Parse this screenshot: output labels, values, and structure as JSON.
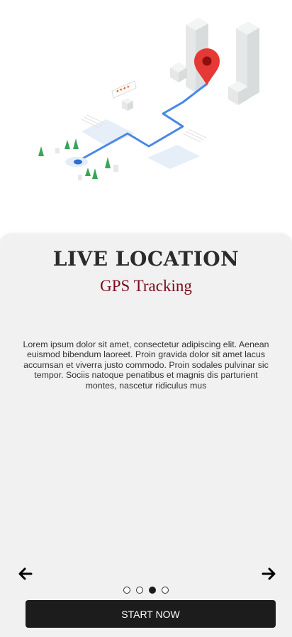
{
  "onboarding": {
    "title": "Live Location",
    "subtitle": "GPS Tracking",
    "description": "Lorem ipsum dolor sit amet, consectetur adipiscing elit. Aenean euismod bibendum laoreet. Proin gravida dolor sit amet lacus accumsan et viverra justo commodo. Proin sodales pulvinar sic tempor. Sociis natoque penatibus et magnis dis parturient montes, nascetur ridiculus mus",
    "page_indicator": {
      "total": 4,
      "current": 3
    },
    "prev_icon": "arrow-left-icon",
    "next_icon": "arrow-right-icon",
    "start_label": "START NOW"
  },
  "colors": {
    "title": "#2b2b2b",
    "subtitle": "#7a0c1c",
    "card_bg": "#f1f1f1",
    "button_bg": "#1c1c1c",
    "route": "#4a88e6",
    "pin": "#e53935",
    "trees": "#3aa55a"
  }
}
